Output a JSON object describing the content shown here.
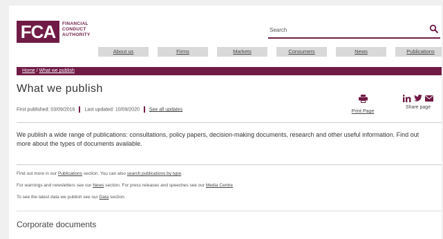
{
  "logo": {
    "letters": "FCA",
    "line1": "FINANCIAL",
    "line2": "CONDUCT",
    "line3": "AUTHORITY"
  },
  "search": {
    "placeholder": "Search",
    "icon": "search-icon"
  },
  "nav": [
    {
      "label": "About us"
    },
    {
      "label": "Firms"
    },
    {
      "label": "Markets"
    },
    {
      "label": "Consumers"
    },
    {
      "label": "News"
    },
    {
      "label": "Publications"
    }
  ],
  "breadcrumb": {
    "home": "Home",
    "separator": "/",
    "current": "What we publish"
  },
  "page": {
    "title": "What we publish",
    "first_published": "First published: 03/09/2016",
    "last_updated": "Last updated: 10/09/2020",
    "see_all_updates": "See all updates",
    "print_label": "Print Page",
    "share_label": "Share page",
    "intro": "We publish a wide range of publications: consultations, policy papers, decision-making documents, research and other useful information. Find out more about the types of documents available.",
    "info": [
      {
        "pre": "Find out more in our ",
        "link1": "Publications",
        "mid": " section. You can also ",
        "link2": "search publications by type",
        "post": "."
      },
      {
        "pre": "For warnings and newsletters see our ",
        "link1": "News",
        "mid": " section. For press releases and speeches see our ",
        "link2": "Media Centre",
        "post": "."
      },
      {
        "pre": "To see the latest data we publish see our ",
        "link1": "Data",
        "mid": " section.",
        "link2": "",
        "post": ""
      }
    ],
    "section_heading": "Corporate documents"
  },
  "colors": {
    "brand": "#701b45",
    "nav_bg": "#d9d9d9"
  },
  "icons": [
    "print-icon",
    "linkedin-icon",
    "twitter-icon",
    "email-icon",
    "search-icon"
  ]
}
